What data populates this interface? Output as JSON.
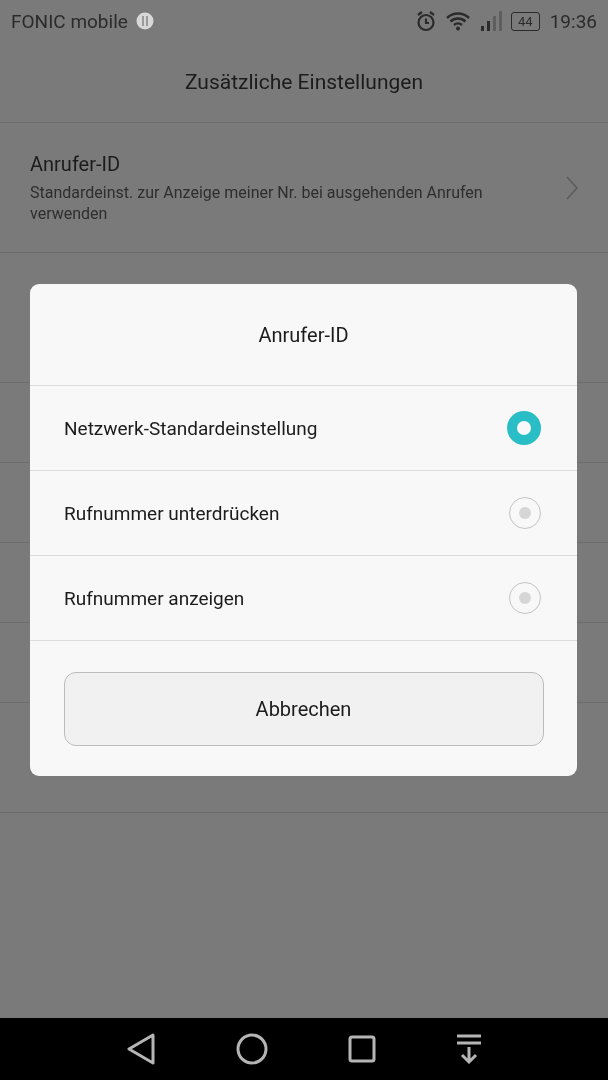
{
  "status_bar": {
    "carrier": "FONIC mobile",
    "battery": "44",
    "time": "19:36"
  },
  "title": "Zusätzliche Einstellungen",
  "settings": [
    {
      "title": "Anrufer-ID",
      "subtitle": "Standardeinst. zur Anzeige meiner Nr. bei ausgehenden Anrufen verwenden",
      "kind": "chevron"
    }
  ],
  "dialog": {
    "title": "Anrufer-ID",
    "options": [
      {
        "label": "Netzwerk-Standardeinstellung",
        "selected": true
      },
      {
        "label": "Rufnummer unterdrücken",
        "selected": false
      },
      {
        "label": "Rufnummer anzeigen",
        "selected": false
      }
    ],
    "cancel": "Abbrechen"
  }
}
